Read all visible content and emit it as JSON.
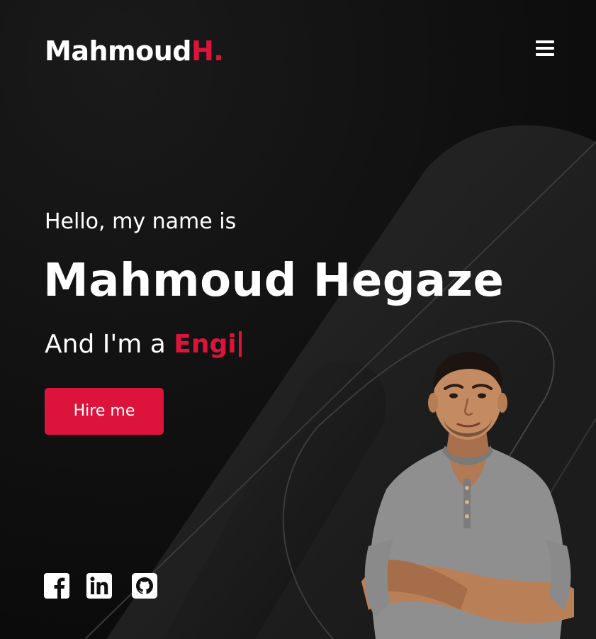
{
  "theme": {
    "accent": "#dc143c",
    "background": "#101010",
    "text": "#ffffff"
  },
  "header": {
    "logo_main": "Mahmoud",
    "logo_accent": "H.",
    "menu_icon": "hamburger-menu-icon"
  },
  "hero": {
    "greeting": "Hello, my name is",
    "name": "Mahmoud Hegaze",
    "role_prefix": "And I'm a ",
    "role_typed": "Engi",
    "hire_button": "Hire me"
  },
  "social": {
    "icons": [
      "facebook-icon",
      "linkedin-icon",
      "github-icon"
    ]
  },
  "portrait": {
    "description_icon": "portrait-photo"
  }
}
